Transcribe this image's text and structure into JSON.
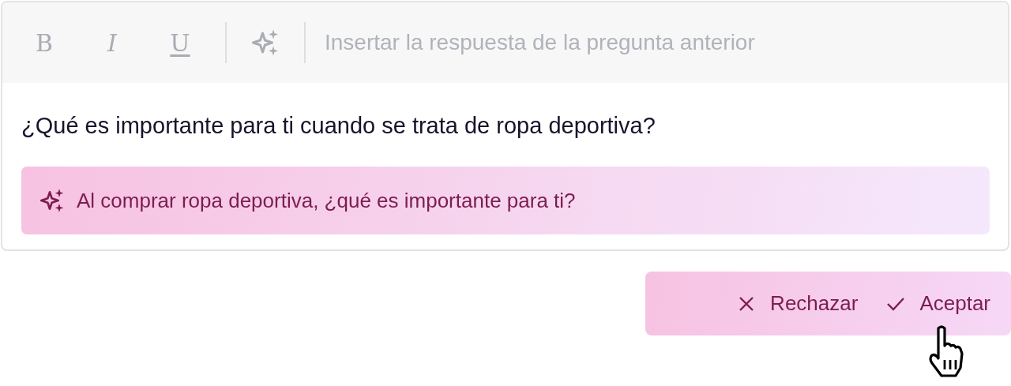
{
  "toolbar": {
    "format_buttons": [
      {
        "label": "B",
        "kind": "bold"
      },
      {
        "label": "I",
        "kind": "italic"
      },
      {
        "label": "U",
        "kind": "underline"
      }
    ],
    "placeholder": "Insertar la respuesta de la pregunta anterior"
  },
  "question": "¿Qué es importante para ti cuando se trata de ropa deportiva?",
  "suggestion": "Al comprar ropa deportiva, ¿qué es importante para ti?",
  "actions": [
    {
      "label": "Rechazar",
      "kind": "reject"
    },
    {
      "label": "Aceptar",
      "kind": "accept"
    }
  ]
}
